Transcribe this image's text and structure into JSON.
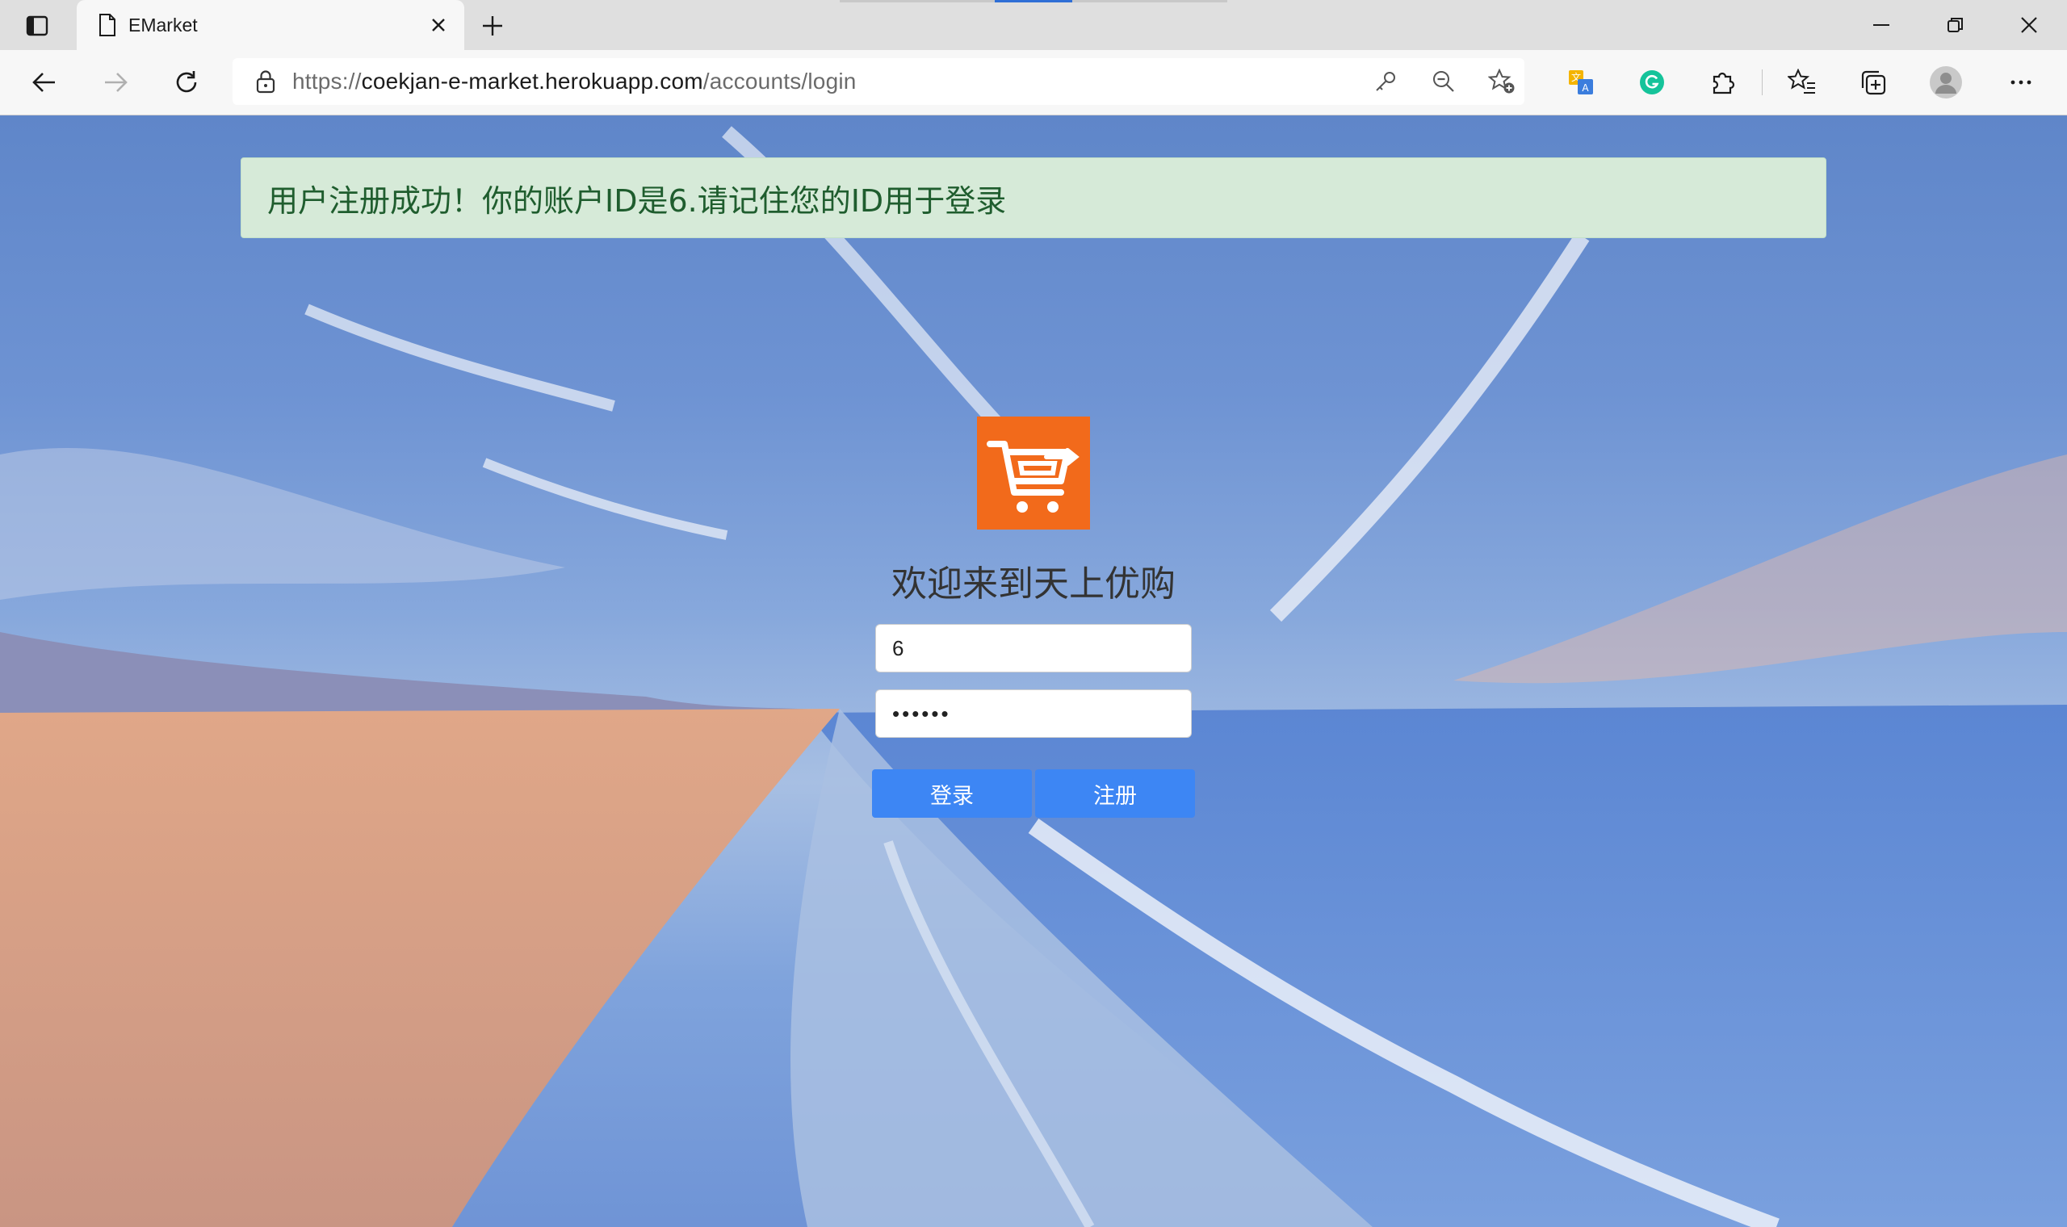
{
  "browser": {
    "tab": {
      "title": "EMarket",
      "icon": "page-icon"
    },
    "address": {
      "scheme": "https://",
      "host": "coekjan-e-market.herokuapp.com",
      "path": "/accounts/login"
    }
  },
  "page": {
    "alert": {
      "text": "用户注册成功！你的账户ID是6.请记住您的ID用于登录"
    },
    "welcome": "欢迎来到天上优购",
    "form": {
      "user_id_value": "6",
      "password_value": "••••••",
      "login_label": "登录",
      "register_label": "注册"
    }
  },
  "colors": {
    "alert_bg": "#d6ead8",
    "alert_text": "#1f5d2e",
    "button_bg": "#3d86f4",
    "logo_orange": "#f26a1b"
  }
}
